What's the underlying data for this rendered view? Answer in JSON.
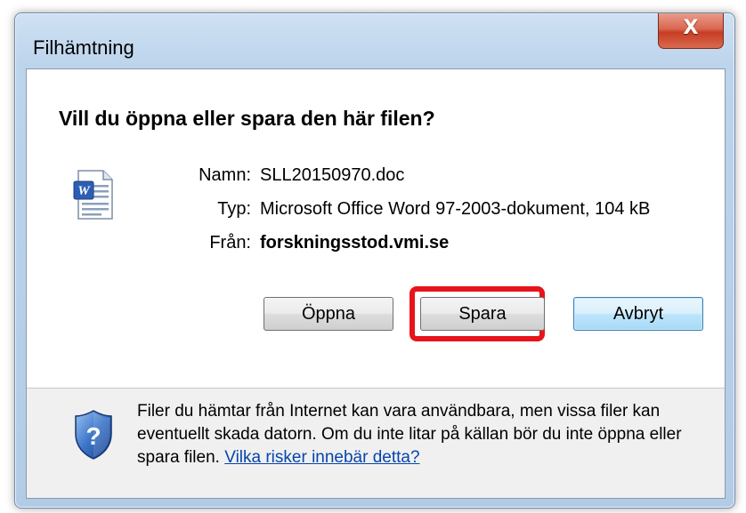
{
  "window": {
    "title": "Filhämtning",
    "close_label": "X"
  },
  "question": "Vill du öppna eller spara den här filen?",
  "file": {
    "icon": "word-document-icon",
    "name_label": "Namn:",
    "name_value": "SLL20150970.doc",
    "type_label": "Typ:",
    "type_value": "Microsoft Office Word 97-2003-dokument, 104 kB",
    "from_label": "Från:",
    "from_value": "forskningsstod.vmi.se"
  },
  "buttons": {
    "open": "Öppna",
    "save": "Spara",
    "cancel": "Avbryt"
  },
  "highlight_color": "#e8141b",
  "warning": {
    "icon": "security-shield-question-icon",
    "text": "Filer du hämtar från Internet kan vara användbara, men vissa filer kan eventuellt skada datorn. Om du inte litar på källan bör du inte öppna eller spara filen.",
    "link": "Vilka risker innebär detta?"
  }
}
